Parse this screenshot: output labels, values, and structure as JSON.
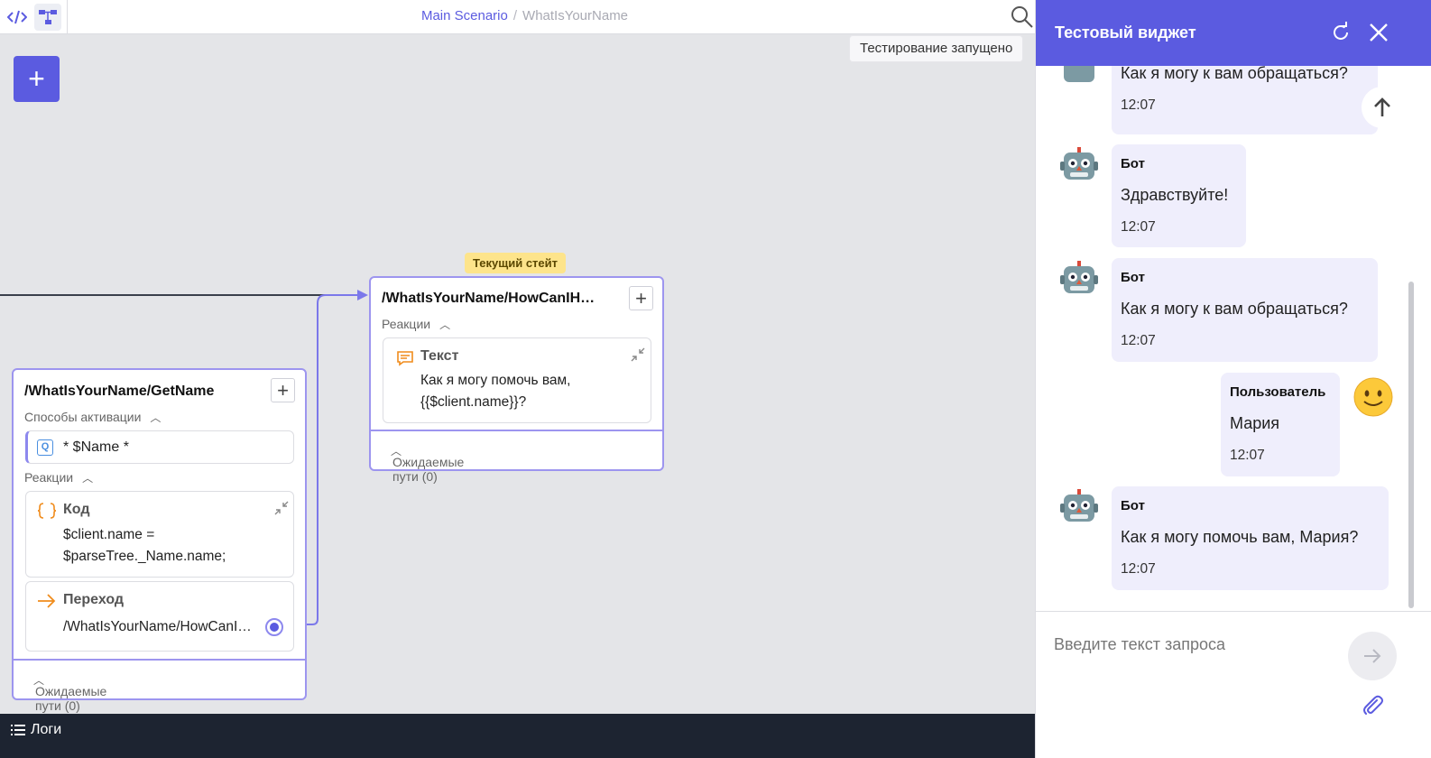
{
  "topbar": {
    "breadcrumb_main": "Main Scenario",
    "breadcrumb_sep": "/",
    "breadcrumb_current": "WhatIsYourName",
    "code_icon": "code-icon",
    "tree_icon": "tree-icon",
    "search_icon": "search-icon"
  },
  "status_text": "Тестирование запущено",
  "add_state_label": "+",
  "current_state_badge": "Текущий стейт",
  "state_getname": {
    "title": "/WhatIsYourName/GetName",
    "activation_label": "Способы активации",
    "intent_badge": "Q",
    "intent_text": "* $Name *",
    "reactions_label": "Реакции",
    "code_title": "Код",
    "code_line1": "$client.name =",
    "code_line2": "$parseTree._Name.name;",
    "transition_title": "Переход",
    "transition_target": "/WhatIsYourName/HowCanI…",
    "expected_paths": "Ожидаемые пути (0)"
  },
  "state_howcani": {
    "title": "/WhatIsYourName/HowCanIH…",
    "reactions_label": "Реакции",
    "text_title": "Текст",
    "text_line1": "Как я могу помочь вам,",
    "text_line2": "{{$client.name}}?",
    "expected_paths": "Ожидаемые пути (0)"
  },
  "logs_label": "Логи",
  "widget": {
    "title": "Тестовый виджет",
    "refresh_icon": "refresh-icon",
    "close_icon": "close-icon",
    "messages": [
      {
        "author": "",
        "text": "Как я могу к вам обращаться?",
        "time": "12:07"
      },
      {
        "author": "Бот",
        "text": "Здравствуйте!",
        "time": "12:07"
      },
      {
        "author": "Бот",
        "text": "Как я могу к вам обращаться?",
        "time": "12:07"
      },
      {
        "author": "Пользователь",
        "text": "Мария",
        "time": "12:07"
      },
      {
        "author": "Бот",
        "text": "Как я могу помочь вам, Мария?",
        "time": "12:07"
      }
    ],
    "input_placeholder": "Введите текст запроса",
    "send_icon": "send-icon",
    "attach_icon": "attach-icon",
    "scroll_up_icon": "arrow-up-icon"
  },
  "colors": {
    "accent": "#5b5be0",
    "state_border": "#9d95ef",
    "badge": "#fde48b",
    "logs_bg": "#1d2431"
  }
}
